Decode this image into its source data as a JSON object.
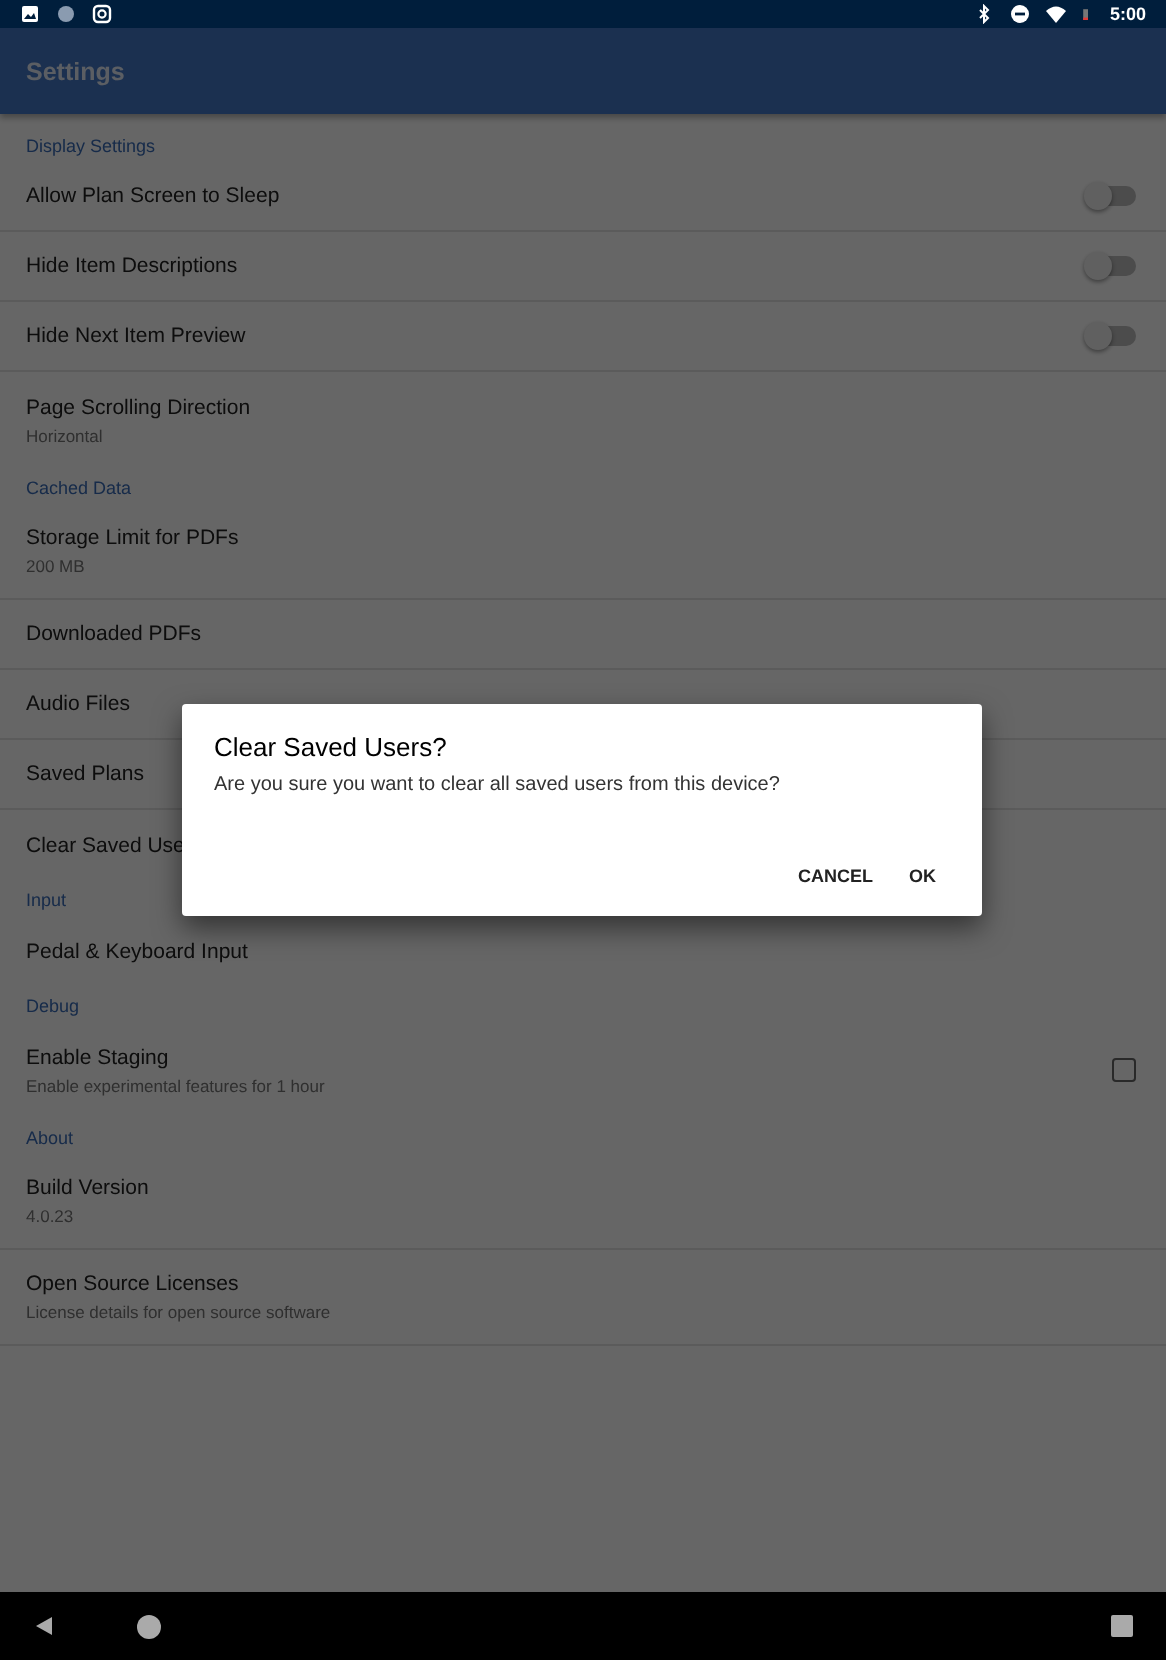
{
  "status_bar": {
    "time": "5:00"
  },
  "app_bar": {
    "title": "Settings"
  },
  "sections": [
    {
      "title": "Display Settings",
      "items": [
        {
          "kind": "switch",
          "title": "Allow Plan Screen to Sleep",
          "on": false
        },
        {
          "kind": "switch",
          "title": "Hide Item Descriptions",
          "on": false
        },
        {
          "kind": "switch",
          "title": "Hide Next Item Preview",
          "on": false
        },
        {
          "kind": "plain",
          "title": "Page Scrolling Direction",
          "summary": "Horizontal"
        }
      ]
    },
    {
      "title": "Cached Data",
      "items": [
        {
          "kind": "plain",
          "title": "Storage Limit for PDFs",
          "summary": "200 MB"
        },
        {
          "kind": "plain",
          "title": "Downloaded PDFs"
        },
        {
          "kind": "plain",
          "title": "Audio Files"
        },
        {
          "kind": "plain",
          "title": "Saved Plans"
        },
        {
          "kind": "plain",
          "title": "Clear Saved Use"
        }
      ]
    },
    {
      "title": "Input",
      "items": [
        {
          "kind": "plain",
          "title": "Pedal & Keyboard Input"
        }
      ]
    },
    {
      "title": "Debug",
      "items": [
        {
          "kind": "checkbox",
          "title": "Enable Staging",
          "summary": "Enable experimental features for 1 hour",
          "checked": false
        }
      ]
    },
    {
      "title": "About",
      "items": [
        {
          "kind": "plain",
          "title": "Build Version",
          "summary": "4.0.23"
        },
        {
          "kind": "plain",
          "title": "Open Source Licenses",
          "summary": "License details for open source software"
        }
      ]
    }
  ],
  "dialog": {
    "title": "Clear Saved Users?",
    "message": "Are you sure you want to clear all saved users from this device?",
    "buttons": [
      "CANCEL",
      "OK"
    ]
  }
}
